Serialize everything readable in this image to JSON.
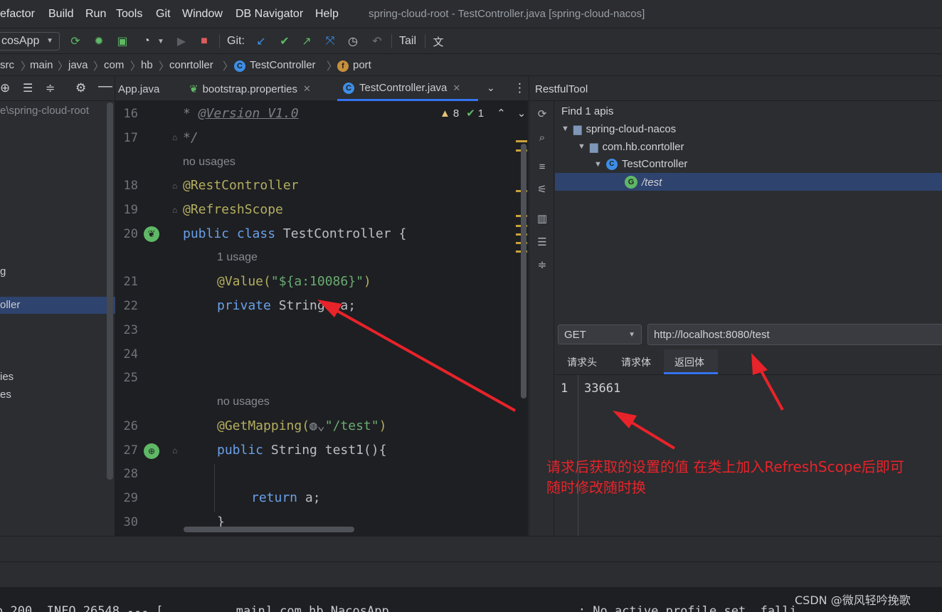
{
  "menu": [
    "efactor",
    "Build",
    "Run",
    "Tools",
    "Git",
    "Window",
    "DB Navigator",
    "Help"
  ],
  "window_title": "spring-cloud-root - TestController.java [spring-cloud-nacos]",
  "toolbar": {
    "run_config": "cosApp",
    "git_label": "Git:",
    "tail_label": "Tail"
  },
  "breadcrumb": [
    "src",
    "main",
    "java",
    "com",
    "hb",
    "conrtoller",
    "TestController",
    "port"
  ],
  "project": {
    "path": "e\\spring-cloud-root",
    "items": [
      "g",
      "oller",
      "ies",
      "es"
    ]
  },
  "editor": {
    "tabs": [
      "App.java",
      "bootstrap.properties",
      "TestController.java"
    ],
    "warnings": "8",
    "checks": "1",
    "line_numbers": [
      "16",
      "17",
      "18",
      "19",
      "20",
      "21",
      "22",
      "23",
      "24",
      "25",
      "26",
      "27",
      "28",
      "29",
      "30"
    ],
    "hints": {
      "no_usages_1": "no usages",
      "one_usage": "1 usage",
      "no_usages_2": "no usages"
    },
    "code": {
      "l16": "@Version V1.0",
      "l17": "*/",
      "l18": "@RestController",
      "l19": "@RefreshScope",
      "l20_kw": "public class",
      "l20_name": "TestController {",
      "l21_ann": "@Value(",
      "l21_str": "\"${a:10086}\"",
      "l22_kw": "private",
      "l22_rest": "String  a;",
      "l26_ann": "@GetMapping(",
      "l26_str": "\"/test\"",
      "l27_kw": "public",
      "l27_type": "String",
      "l27_fn": "test1(){",
      "l29_kw": "return",
      "l29_rest": "a;",
      "l30": "}"
    }
  },
  "restful": {
    "title": "RestfulTool",
    "found": "Find 1 apis",
    "tree": [
      "spring-cloud-nacos",
      "com.hb.conrtoller",
      "TestController",
      "/test"
    ],
    "method": "GET",
    "url": "http://localhost:8080/test",
    "tabs": [
      "请求头",
      "请求体",
      "返回体"
    ],
    "response_line": "1",
    "response_value": "33661"
  },
  "annotation": {
    "line1": "请求后获取的设置的值 在类上加入RefreshScope后即可",
    "line2": "随时修改随时换"
  },
  "console": "o.200  INFO 26548 --- [          main] com.hb.NacosApp                          : No active profile set, falli",
  "watermark": "CSDN @微风轻吟挽歌"
}
